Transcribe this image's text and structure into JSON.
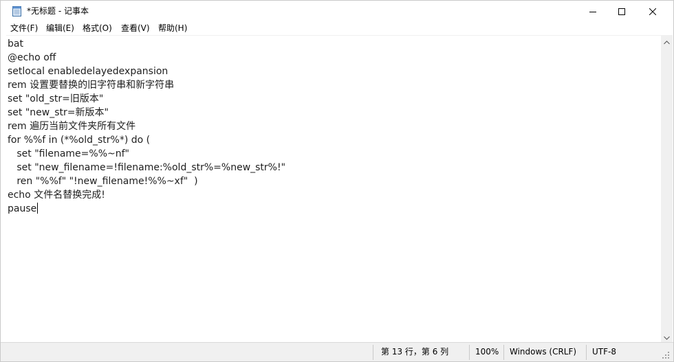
{
  "window": {
    "title": "*无标题 - 记事本",
    "controls": {
      "minimize": "minimize",
      "maximize": "maximize",
      "close": "close"
    }
  },
  "menu": {
    "file": "文件(F)",
    "edit": "编辑(E)",
    "format": "格式(O)",
    "view": "查看(V)",
    "help": "帮助(H)"
  },
  "editor": {
    "lines": [
      "bat",
      "@echo off",
      "setlocal enabledelayedexpansion",
      "rem 设置要替换的旧字符串和新字符串",
      "set \"old_str=旧版本\"",
      "set \"new_str=新版本\"",
      "rem 遍历当前文件夹所有文件",
      "for %%f in (*%old_str%*) do (",
      "   set \"filename=%%~nf\"",
      "   set \"new_filename=!filename:%old_str%=%new_str%!\"",
      "   ren \"%%f\" \"!new_filename!%%~xf\"  )",
      "echo 文件名替换完成!",
      "pause"
    ]
  },
  "status": {
    "position": "第 13 行，第 6 列",
    "zoom": "100%",
    "line_ending": "Windows (CRLF)",
    "encoding": "UTF-8"
  },
  "icons": {
    "app": "notepad-icon",
    "minimize": "minimize-icon",
    "maximize": "maximize-icon",
    "close": "close-icon",
    "scroll_up": "chevron-up-icon",
    "scroll_down": "chevron-down-icon",
    "grip": "resize-grip-icon"
  }
}
